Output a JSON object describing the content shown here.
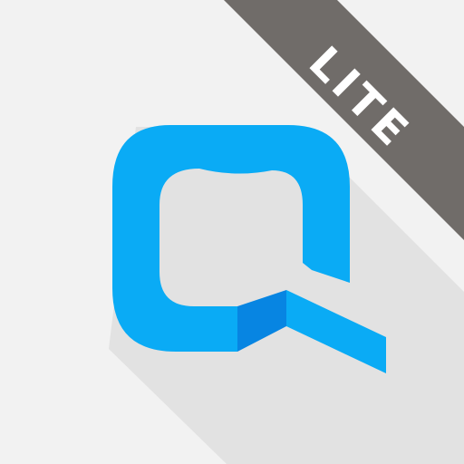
{
  "badge": {
    "label": "LITE"
  },
  "colors": {
    "background": "#f2f2f2",
    "shadow": "#e2e2e2",
    "ribbon": "#706c69",
    "ribbon_text": "#ffffff",
    "logo": "#0aabf5",
    "logo_fold": "#0785e2"
  },
  "icons": {
    "logo": "chat-bubble-q-logo"
  }
}
